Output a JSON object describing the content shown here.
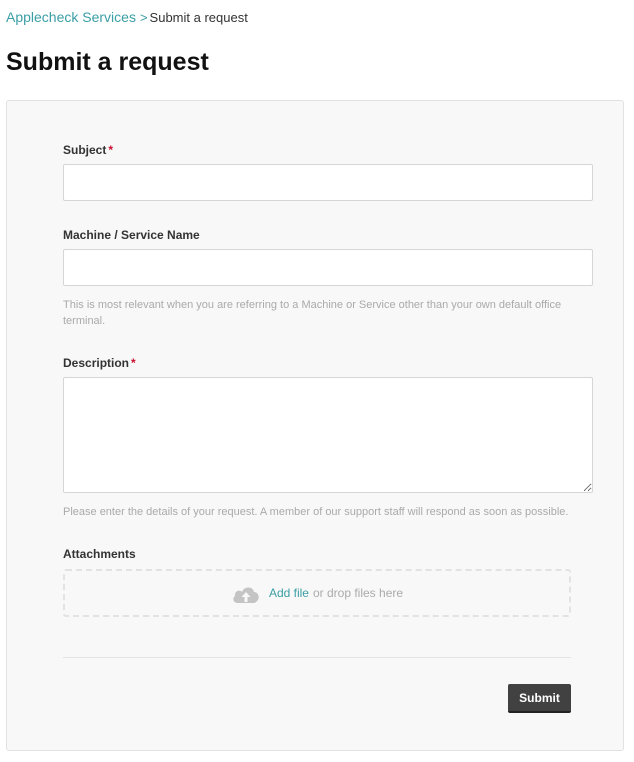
{
  "breadcrumb": {
    "parent": "Applecheck Services",
    "separator": ">",
    "current": "Submit a request"
  },
  "page": {
    "title": "Submit a request"
  },
  "form": {
    "subject": {
      "label": "Subject",
      "required_mark": "*",
      "value": ""
    },
    "machine": {
      "label": "Machine / Service Name",
      "value": "",
      "hint": "This is most relevant when you are referring to a Machine or Service other than your own default office terminal."
    },
    "description": {
      "label": "Description",
      "required_mark": "*",
      "value": "",
      "hint": "Please enter the details of your request. A member of our support staff will respond as soon as possible."
    },
    "attachments": {
      "label": "Attachments",
      "add_file": "Add file",
      "drop_text": "or drop files here",
      "icon": "cloud-upload-icon"
    },
    "submit_label": "Submit"
  },
  "colors": {
    "link": "#3a9ea5",
    "required": "#c8102e",
    "button": "#414141",
    "panel": "#f8f8f8"
  }
}
